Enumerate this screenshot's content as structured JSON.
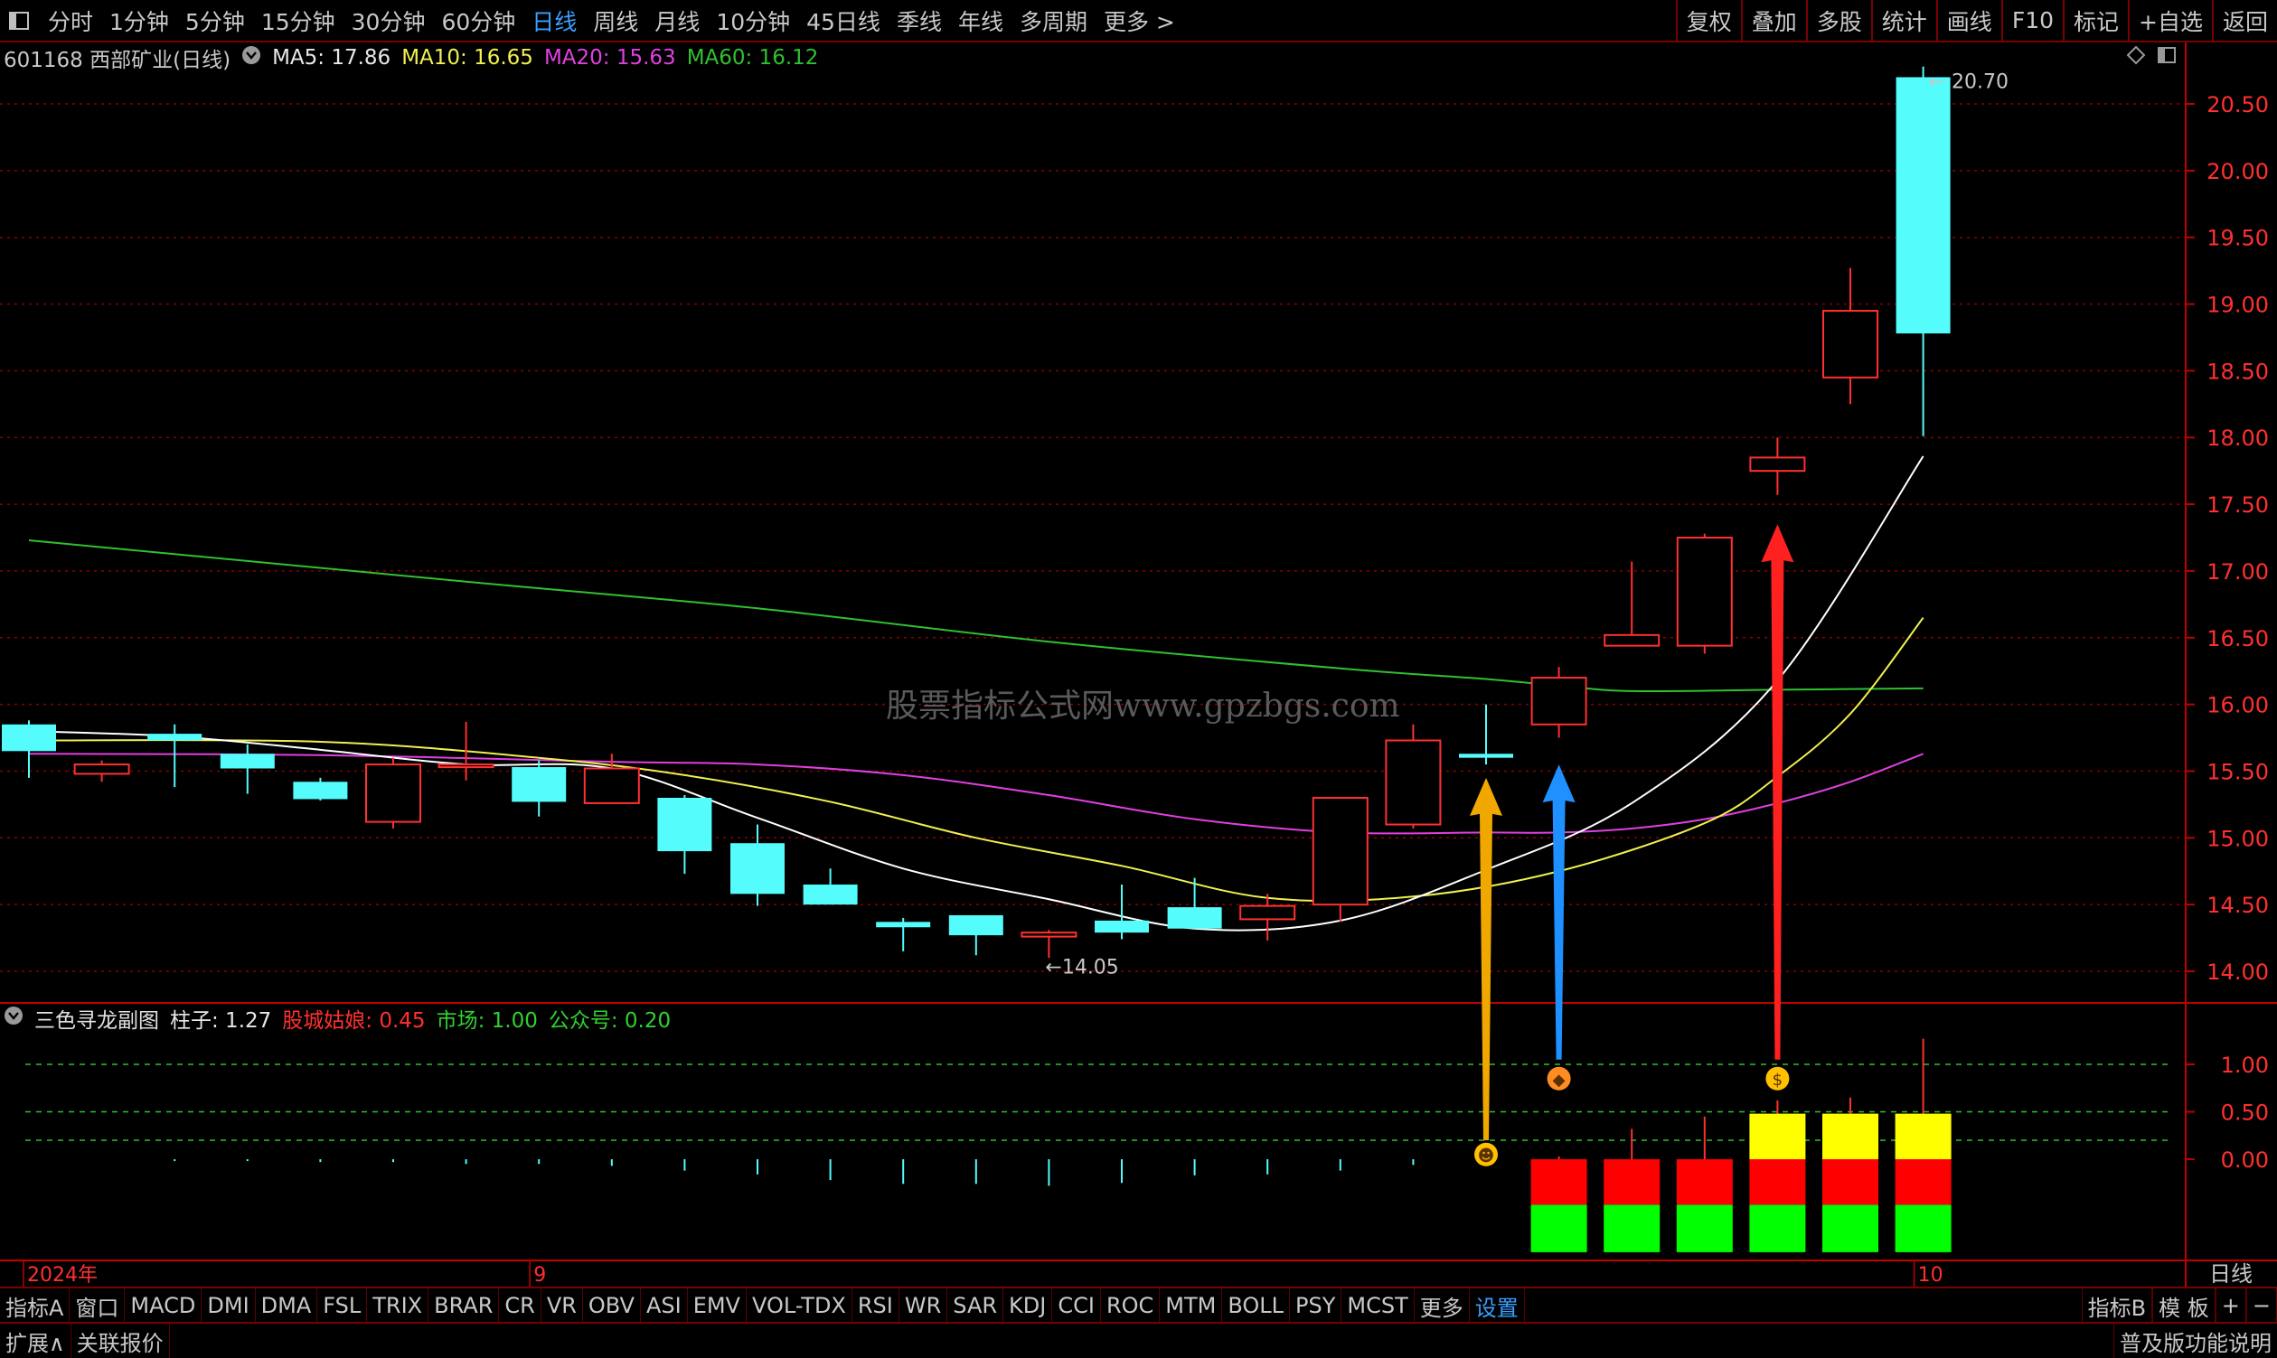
{
  "toolbar": {
    "periods": [
      "分时",
      "1分钟",
      "5分钟",
      "15分钟",
      "30分钟",
      "60分钟",
      "日线",
      "周线",
      "月线",
      "10分钟",
      "45日线",
      "季线",
      "年线",
      "多周期",
      "更多 >"
    ],
    "active_period": "日线",
    "right_buttons": [
      "复权",
      "叠加",
      "多股",
      "统计",
      "画线",
      "F10",
      "标记",
      "+自选",
      "返回"
    ]
  },
  "info": {
    "stock": "601168 西部矿业(日线)",
    "ma5": "MA5: 17.86",
    "ma10": "MA10: 16.65",
    "ma20": "MA20: 15.63",
    "ma60": "MA60: 16.12"
  },
  "sub_info": {
    "name": "三色寻龙副图",
    "zhuzi": "柱子: 1.27",
    "gucheng": "股城姑娘: 0.45",
    "shichang": "市场: 1.00",
    "gongzhonghao": "公众号: 0.20"
  },
  "watermark": "股票指标公式网www.gpzbgs.com",
  "colors": {
    "up": "#ff3030",
    "down": "#54fcfc",
    "ma5": "#ffffff",
    "ma10": "#f0f050",
    "ma20": "#e040e0",
    "ma60": "#30c030",
    "grid": "#8b0000",
    "axis": "#c00000",
    "arrow_orange": "#f0a800",
    "arrow_blue": "#1e90ff",
    "arrow_red": "#ff2020"
  },
  "chart_data": [
    {
      "type": "candlestick",
      "title": "601168 西部矿业(日线)",
      "ylim": [
        13.7,
        21.05
      ],
      "y_ticks": [
        14.0,
        14.5,
        15.0,
        15.5,
        16.0,
        16.5,
        17.0,
        17.5,
        18.0,
        18.5,
        19.0,
        19.5,
        20.0,
        20.5
      ],
      "y_tick_labels": [
        "14.00",
        "14.50",
        "15.00",
        "15.50",
        "16.00",
        "16.50",
        "17.00",
        "17.50",
        "18.00",
        "18.50",
        "19.00",
        "19.50",
        "20.00",
        "20.50"
      ],
      "x_labels": [
        "2024年",
        "9",
        "10"
      ],
      "x_label_index": [
        0,
        7,
        26
      ],
      "high_label": "20.70",
      "low_label": "14.05",
      "candles": [
        {
          "o": 15.85,
          "h": 15.88,
          "c": 15.65,
          "l": 15.45
        },
        {
          "o": 15.48,
          "h": 15.58,
          "c": 15.55,
          "l": 15.42
        },
        {
          "o": 15.78,
          "h": 15.85,
          "c": 15.73,
          "l": 15.38
        },
        {
          "o": 15.63,
          "h": 15.7,
          "c": 15.52,
          "l": 15.33
        },
        {
          "o": 15.42,
          "h": 15.45,
          "c": 15.29,
          "l": 15.28
        },
        {
          "o": 15.12,
          "h": 15.6,
          "c": 15.55,
          "l": 15.07
        },
        {
          "o": 15.54,
          "h": 15.87,
          "c": 15.55,
          "l": 15.43
        },
        {
          "o": 15.53,
          "h": 15.58,
          "c": 15.27,
          "l": 15.16
        },
        {
          "o": 15.26,
          "h": 15.63,
          "c": 15.52,
          "l": 15.26
        },
        {
          "o": 15.3,
          "h": 15.32,
          "c": 14.9,
          "l": 14.73
        },
        {
          "o": 14.96,
          "h": 15.1,
          "c": 14.58,
          "l": 14.49
        },
        {
          "o": 14.65,
          "h": 14.77,
          "c": 14.5,
          "l": 14.5
        },
        {
          "o": 14.37,
          "h": 14.4,
          "c": 14.33,
          "l": 14.15
        },
        {
          "o": 14.42,
          "h": 14.42,
          "c": 14.27,
          "l": 14.12
        },
        {
          "o": 14.26,
          "h": 14.31,
          "c": 14.29,
          "l": 14.1
        },
        {
          "o": 14.38,
          "h": 14.65,
          "c": 14.29,
          "l": 14.24
        },
        {
          "o": 14.48,
          "h": 14.7,
          "c": 14.32,
          "l": 14.32
        },
        {
          "o": 14.39,
          "h": 14.58,
          "c": 14.49,
          "l": 14.23
        },
        {
          "o": 14.5,
          "h": 15.3,
          "c": 15.3,
          "l": 14.37
        },
        {
          "o": 15.1,
          "h": 15.85,
          "c": 15.73,
          "l": 15.07
        },
        {
          "o": 15.63,
          "h": 16.0,
          "c": 15.6,
          "l": 15.55
        },
        {
          "o": 15.85,
          "h": 16.28,
          "c": 16.2,
          "l": 15.75
        },
        {
          "o": 16.44,
          "h": 17.07,
          "c": 16.52,
          "l": 16.52
        },
        {
          "o": 16.44,
          "h": 17.28,
          "c": 17.25,
          "l": 16.38
        },
        {
          "o": 17.75,
          "h": 18.0,
          "c": 17.85,
          "l": 17.57
        },
        {
          "o": 18.45,
          "h": 19.27,
          "c": 18.95,
          "l": 18.25
        },
        {
          "o": 20.7,
          "h": 20.78,
          "c": 18.78,
          "l": 18.01
        }
      ],
      "ma5_x": [
        0,
        2,
        4,
        6,
        8,
        10,
        12,
        14,
        16,
        18,
        20,
        22,
        24,
        26
      ],
      "ma5": [
        15.8,
        15.76,
        15.66,
        15.55,
        15.52,
        15.15,
        14.77,
        14.54,
        14.32,
        14.38,
        14.76,
        15.26,
        16.18,
        17.86
      ],
      "ma10_x": [
        0,
        4,
        7,
        9,
        11,
        13,
        15,
        17,
        19,
        21,
        23,
        24,
        25,
        26
      ],
      "ma10": [
        15.73,
        15.72,
        15.6,
        15.47,
        15.27,
        15.0,
        14.79,
        14.55,
        14.56,
        14.75,
        15.11,
        15.46,
        15.93,
        16.65
      ],
      "ma20_x": [
        0,
        4,
        8,
        10,
        12,
        14,
        16,
        18,
        20,
        21,
        22,
        23,
        24,
        25,
        26
      ],
      "ma20": [
        15.63,
        15.62,
        15.57,
        15.55,
        15.47,
        15.32,
        15.14,
        15.04,
        15.04,
        15.04,
        15.07,
        15.14,
        15.26,
        15.42,
        15.63
      ],
      "ma60_x": [
        0,
        6,
        10,
        14,
        18,
        20,
        21,
        22,
        24,
        26
      ],
      "ma60": [
        17.23,
        16.92,
        16.72,
        16.47,
        16.27,
        16.19,
        16.14,
        16.1,
        16.11,
        16.12
      ]
    },
    {
      "type": "bar",
      "title": "三色寻龙副图",
      "ylim": [
        -0.72,
        1.17
      ],
      "y_ticks": [
        0.0,
        0.5,
        1.0
      ],
      "y_tick_labels": [
        "0.00",
        "0.50",
        "1.00"
      ],
      "dashed_levels": [
        1.0,
        0.5,
        0.2
      ],
      "thin_lines": [
        0.0,
        0.0,
        -0.02,
        -0.02,
        -0.03,
        -0.03,
        -0.05,
        -0.05,
        -0.07,
        -0.12,
        -0.16,
        -0.22,
        -0.26,
        -0.26,
        -0.28,
        -0.25,
        -0.17,
        -0.16,
        -0.12,
        -0.06,
        0.0,
        0.03,
        0.32,
        0.45,
        0.62,
        0.65,
        1.27
      ],
      "stack_indices": [
        21,
        22,
        23,
        24,
        25,
        26
      ],
      "stack_segments": [
        [
          {
            "from": -0.98,
            "to": -0.48,
            "color": "#00ff00"
          },
          {
            "from": -0.48,
            "to": 0,
            "color": "#ff0000"
          }
        ],
        [
          {
            "from": -0.98,
            "to": -0.48,
            "color": "#00ff00"
          },
          {
            "from": -0.48,
            "to": 0,
            "color": "#ff0000"
          }
        ],
        [
          {
            "from": -0.98,
            "to": -0.48,
            "color": "#00ff00"
          },
          {
            "from": -0.48,
            "to": 0,
            "color": "#ff0000"
          }
        ],
        [
          {
            "from": -0.98,
            "to": -0.48,
            "color": "#00ff00"
          },
          {
            "from": -0.48,
            "to": 0,
            "color": "#ff0000"
          },
          {
            "from": 0,
            "to": 0.48,
            "color": "#ffff00"
          }
        ],
        [
          {
            "from": -0.98,
            "to": -0.48,
            "color": "#00ff00"
          },
          {
            "from": -0.48,
            "to": 0,
            "color": "#ff0000"
          },
          {
            "from": 0,
            "to": 0.48,
            "color": "#ffff00"
          }
        ],
        [
          {
            "from": -0.98,
            "to": -0.48,
            "color": "#00ff00"
          },
          {
            "from": -0.48,
            "to": 0,
            "color": "#ff0000"
          },
          {
            "from": 0,
            "to": 0.48,
            "color": "#ffff00"
          }
        ]
      ],
      "markers": [
        {
          "index": 20,
          "value": 0.05,
          "icon": "smiley-icon",
          "glyph": "☻",
          "color": "#ffc000"
        },
        {
          "index": 21,
          "value": 0.85,
          "icon": "diamond-icon",
          "glyph": "◆",
          "color": "#ff8c20"
        },
        {
          "index": 24,
          "value": 0.85,
          "icon": "money-bag-icon",
          "glyph": "$",
          "color": "#ffc000"
        }
      ],
      "arrows": [
        {
          "index": 20,
          "from_value": 0.2,
          "to_price": 15.45,
          "color": "#f0a800"
        },
        {
          "index": 21,
          "from_value": 1.05,
          "to_price": 15.55,
          "color": "#1e90ff"
        },
        {
          "index": 24,
          "from_value": 1.05,
          "to_price": 17.35,
          "color": "#ff2020"
        }
      ],
      "x_period_label": "日线"
    }
  ],
  "indicators": [
    "指标A",
    "窗口",
    "MACD",
    "DMI",
    "DMA",
    "FSL",
    "TRIX",
    "BRAR",
    "CR",
    "VR",
    "OBV",
    "ASI",
    "EMV",
    "VOL-TDX",
    "RSI",
    "WR",
    "SAR",
    "KDJ",
    "CCI",
    "ROC",
    "MTM",
    "BOLL",
    "PSY",
    "MCST",
    "更多",
    "设置"
  ],
  "indicator_active": "设置",
  "indicator_right": [
    "指标B",
    "模 板",
    "+",
    "−"
  ],
  "status": {
    "left1": "扩展∧",
    "left2": "关联报价",
    "right": "普及版功能说明"
  }
}
